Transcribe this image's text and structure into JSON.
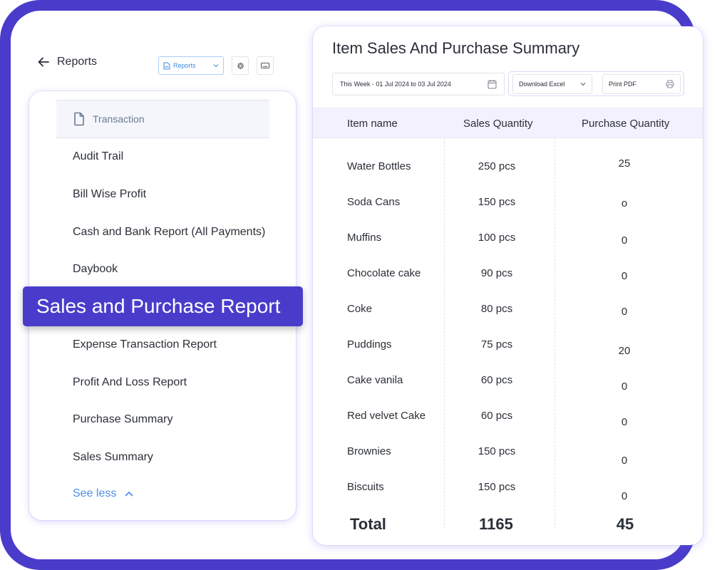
{
  "header": {
    "back_title": "Reports",
    "reports_select": {
      "value": "Reports",
      "icon": "report-file-icon"
    },
    "icon_buttons": [
      "gear-icon",
      "keyboard-icon"
    ]
  },
  "sidebar": {
    "section": {
      "label": "Transaction",
      "icon": "document-icon"
    },
    "items": [
      {
        "label": "Audit Trail"
      },
      {
        "label": "Bill Wise Profit"
      },
      {
        "label": "Cash and Bank Report (All Payments)"
      },
      {
        "label": "Daybook"
      },
      {
        "label": "Expense Transaction Report"
      },
      {
        "label": "Profit And Loss Report"
      },
      {
        "label": "Purchase Summary"
      },
      {
        "label": "Sales Summary"
      }
    ],
    "highlighted": {
      "label": "Sales and Purchase Report"
    },
    "see_less": "See less"
  },
  "report": {
    "title": "Item Sales And Purchase Summary",
    "date_range": "This Week - 01 Jul 2024 to 03 Jul 2024",
    "download_select": "Download Excel",
    "print_label": "Print PDF",
    "columns": [
      "Item name",
      "Sales Quantity",
      "Purchase Quantity"
    ],
    "rows": [
      {
        "name": "Water Bottles",
        "sales": "250 pcs",
        "purchase": "25"
      },
      {
        "name": "Soda Cans",
        "sales": "150 pcs",
        "purchase": "o"
      },
      {
        "name": "Muffins",
        "sales": "100 pcs",
        "purchase": "0"
      },
      {
        "name": "Chocolate cake",
        "sales": "90 pcs",
        "purchase": "0"
      },
      {
        "name": "Coke",
        "sales": "80 pcs",
        "purchase": "0"
      },
      {
        "name": "Puddings",
        "sales": "75 pcs",
        "purchase": "20"
      },
      {
        "name": "Cake vanila",
        "sales": "60 pcs",
        "purchase": "0"
      },
      {
        "name": "Red velvet Cake",
        "sales": "60 pcs",
        "purchase": "0"
      },
      {
        "name": "Brownies",
        "sales": "150 pcs",
        "purchase": "0"
      },
      {
        "name": "Biscuits",
        "sales": "150 pcs",
        "purchase": "0"
      }
    ],
    "total": {
      "label": "Total",
      "sales": "1165",
      "purchase": "45"
    }
  },
  "colors": {
    "brand": "#4a3ccb",
    "link": "#4a90f0",
    "header_row": "#f3f1fd"
  }
}
